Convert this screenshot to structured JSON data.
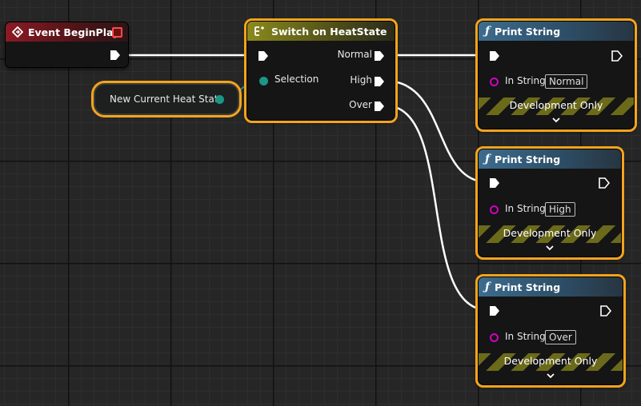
{
  "event_node": {
    "title": "Event BeginPlay",
    "icon": "event-diamond-icon"
  },
  "variable_node": {
    "label": "New Current Heat State"
  },
  "switch_node": {
    "title": "Switch on HeatState",
    "icon": "switch-icon",
    "input_label": "Selection",
    "outputs": [
      "Normal",
      "High",
      "Over"
    ]
  },
  "print_nodes": [
    {
      "title": "Print String",
      "icon": "function-f-icon",
      "in_string_label": "In String",
      "in_string_value": "Normal",
      "footer": "Development Only"
    },
    {
      "title": "Print String",
      "icon": "function-f-icon",
      "in_string_label": "In String",
      "in_string_value": "High",
      "footer": "Development Only"
    },
    {
      "title": "Print String",
      "icon": "function-f-icon",
      "in_string_label": "In String",
      "in_string_value": "Over",
      "footer": "Development Only"
    }
  ],
  "colors": {
    "selection_outline": "#f5a41c",
    "exec_wire": "#ffffff",
    "enum_pin": "#1b9687",
    "string_pin": "#d000c4"
  }
}
